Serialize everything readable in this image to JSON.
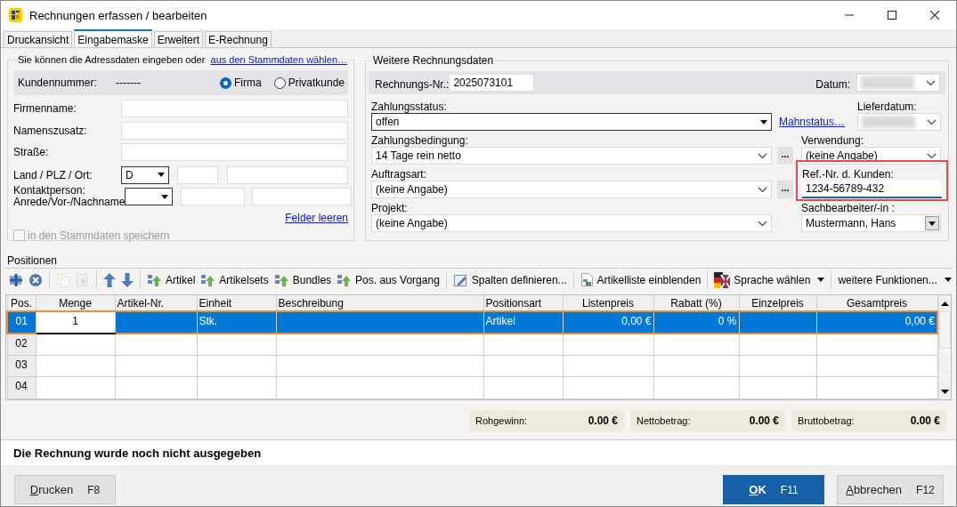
{
  "window": {
    "title": "Rechnungen erfassen / bearbeiten"
  },
  "tabs": [
    {
      "label": "Druckansicht",
      "selected": false
    },
    {
      "label": "Eingabemaske",
      "selected": true
    },
    {
      "label": "Erweitert",
      "selected": false
    },
    {
      "label": "E-Rechnung",
      "selected": false
    }
  ],
  "address": {
    "intro": "Sie können die Adressdaten eingeben oder",
    "intro_link": "aus den Stammdaten wählen…",
    "customer_number_label": "Kundennummer:",
    "customer_number": "-------",
    "customer_types": [
      {
        "label": "Firma",
        "selected": true
      },
      {
        "label": "Privatkunde",
        "selected": false
      }
    ],
    "fields": [
      {
        "kind": "text",
        "label": "Firmenname:"
      },
      {
        "kind": "text",
        "label": "Namenszusatz:"
      },
      {
        "kind": "text",
        "label": "Straße:"
      },
      {
        "kind": "country",
        "label": "Land / PLZ / Ort:",
        "value": "D"
      },
      {
        "kind": "contact",
        "label_lines": [
          "Kontaktperson:",
          "Anrede/Vor-/Nachname"
        ]
      }
    ],
    "clear_link": "Felder leeren",
    "save_checkbox": {
      "label": "in den Stammdaten speichern",
      "checked": false,
      "disabled": true
    }
  },
  "invoice": {
    "title": "Weitere Rechnungsdaten",
    "number_label": "Rechnungs-Nr.:",
    "number": "2025073101",
    "date_label": "Datum:",
    "payment_status": {
      "label": "Zahlungsstatus:",
      "value": "offen"
    },
    "dunning_link": "Mahnstatus…",
    "delivery_date_label": "Lieferdatum:",
    "payment_terms": {
      "label": "Zahlungsbedingung:",
      "value": "14 Tage rein netto",
      "more": "..."
    },
    "usage": {
      "label": "Verwendung:",
      "value": "(keine Angabe)"
    },
    "order_type": {
      "label": "Auftragsart:",
      "value": "(keine Angabe)",
      "more": "..."
    },
    "customer_ref": {
      "label": "Ref.-Nr. d. Kunden:",
      "value": "1234-56789-432",
      "highlighted": true
    },
    "project": {
      "label": "Projekt:",
      "value": "(keine Angabe)"
    },
    "clerk": {
      "label": "Sachbearbeiter/-in :",
      "value": "Mustermann, Hans"
    }
  },
  "positions": {
    "title": "Positionen",
    "toolbar": [
      [
        {
          "disabled": false
        },
        {
          "disabled": false
        }
      ],
      [
        {
          "disabled": true
        },
        {
          "disabled": true
        }
      ],
      [
        {
          "disabled": false
        },
        {
          "disabled": false
        }
      ],
      [
        {
          "label": "Artikel"
        },
        {
          "label": "Artikelsets"
        },
        {
          "label": "Bundles"
        },
        {
          "label": "Pos. aus Vorgang"
        }
      ],
      [
        {
          "label": "Spalten definieren..."
        }
      ],
      [
        {
          "label": "Artikelliste einblenden"
        }
      ],
      [
        {
          "label": "Sprache wählen",
          "dropdown": true
        }
      ],
      [
        {
          "label": "weitere Funktionen...",
          "dropdown": true
        }
      ]
    ],
    "columns": [
      "Pos.",
      "Menge",
      "Artikel-Nr.",
      "Einheit",
      "Beschreibung",
      "Positionsart",
      "Listenpreis",
      "Rabatt (%)",
      "Einzelpreis",
      "Gesamtpreis"
    ],
    "rows": [
      {
        "selected": true,
        "cells": [
          "01",
          "1",
          null,
          "Stk.",
          null,
          "Artikel",
          "0,00 €",
          "0 %",
          null,
          "0,00 €"
        ]
      },
      {
        "selected": false,
        "cells": [
          "02",
          null,
          null,
          null,
          null,
          null,
          null,
          null,
          null,
          null
        ]
      },
      {
        "selected": false,
        "cells": [
          "03",
          null,
          null,
          null,
          null,
          null,
          null,
          null,
          null,
          null
        ]
      },
      {
        "selected": false,
        "cells": [
          "04",
          null,
          null,
          null,
          null,
          null,
          null,
          null,
          null,
          null
        ]
      }
    ]
  },
  "totals": [
    {
      "label": "Rohgewinn:",
      "value": "0.00 €"
    },
    {
      "label": "Nettobetrag:",
      "value": "0.00 €"
    },
    {
      "label": "Bruttobetrag:",
      "value": "0.00 €"
    }
  ],
  "status_message": "Die Rechnung wurde noch nicht ausgegeben",
  "buttons": [
    {
      "kind": "normal",
      "label": "Drucken",
      "shortcut": "F8"
    },
    {
      "kind": "primary",
      "label": "OK",
      "shortcut": "F11"
    },
    {
      "kind": "normal",
      "label": "Abbrechen",
      "shortcut": "F12"
    }
  ]
}
